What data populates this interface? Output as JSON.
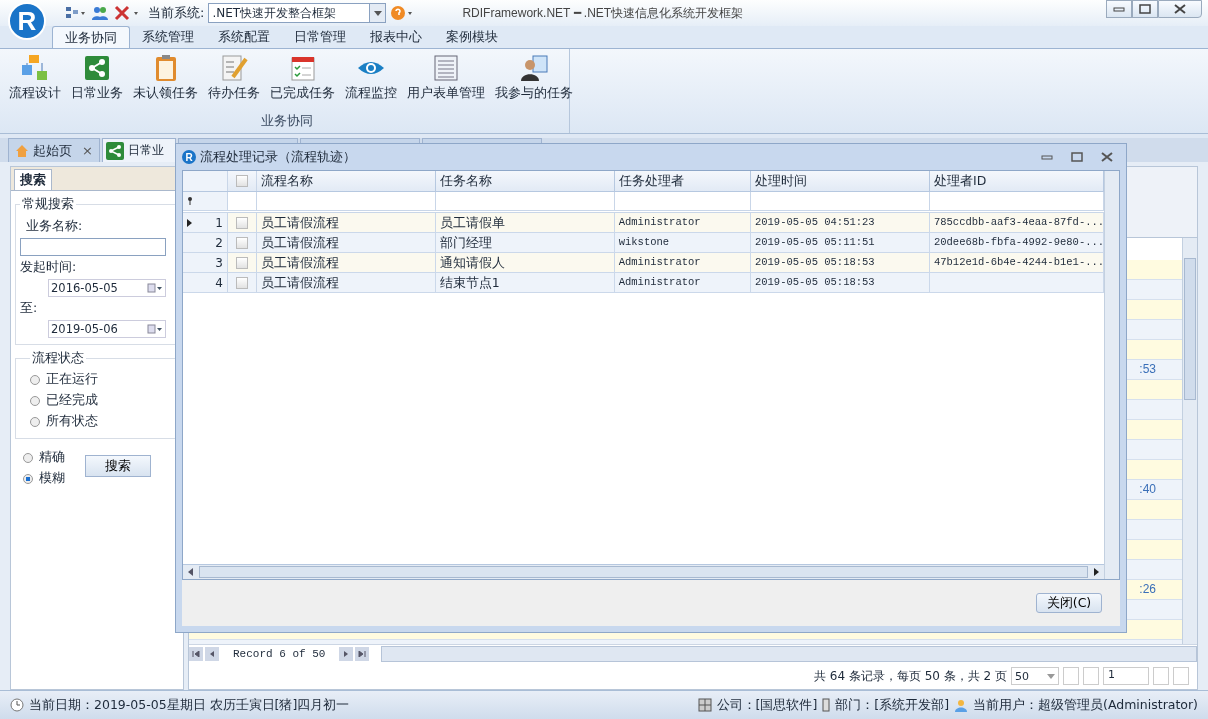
{
  "app": {
    "logo": "R",
    "system_label": "当前系统:",
    "system_value": ".NET快速开发整合框架",
    "title": "RDIFramework.NET ━ .NET快速信息化系统开发框架"
  },
  "ribbon_tabs": [
    {
      "label": "业务协同",
      "selected": true
    },
    {
      "label": "系统管理",
      "selected": false
    },
    {
      "label": "系统配置",
      "selected": false
    },
    {
      "label": "日常管理",
      "selected": false
    },
    {
      "label": "报表中心",
      "selected": false
    },
    {
      "label": "案例模块",
      "selected": false
    }
  ],
  "ribbon_group": {
    "label": "业务协同",
    "buttons": [
      "流程设计",
      "日常业务",
      "未认领任务",
      "待办任务",
      "已完成任务",
      "流程监控",
      "用户表单管理",
      "我参与的任务"
    ]
  },
  "doc_tabs": [
    {
      "label": "起始页",
      "close": "×",
      "selected": false
    },
    {
      "label": "日常业",
      "selected": true
    }
  ],
  "search_panel": {
    "tab": "搜索",
    "group": "常规搜索",
    "name_label": "业务名称:",
    "start_label": "发起时间:",
    "start_value": "2016-05-05",
    "end_label": "至:",
    "end_value": "2019-05-06",
    "status_group": "流程状态",
    "status_options": [
      {
        "label": "正在运行",
        "selected": false
      },
      {
        "label": "已经完成",
        "selected": false
      },
      {
        "label": "所有状态",
        "selected": false
      }
    ],
    "match_options": [
      {
        "label": "精确",
        "selected": false
      },
      {
        "label": "模糊",
        "selected": true
      }
    ],
    "search_button": "搜索"
  },
  "main_grid": {
    "visible_cells": [
      ":53",
      ":40",
      ":26"
    ],
    "pager": "Record 6 of 50",
    "footer": "共 64 条记录，每页 50 条，共 2 页",
    "page_size": "50",
    "page": "1"
  },
  "dialog": {
    "logo": "R",
    "title": "流程处理记录（流程轨迹）",
    "columns": [
      "流程名称",
      "任务名称",
      "任务处理者",
      "处理时间",
      "处理者ID"
    ],
    "rows": [
      {
        "num": "1",
        "current": true,
        "checked": false,
        "cells": [
          "员工请假流程",
          "员工请假单",
          "Administrator",
          "2019-05-05 04:51:23",
          "785ccdbb-aaf3-4eaa-87fd-..."
        ]
      },
      {
        "num": "2",
        "current": false,
        "checked": false,
        "cells": [
          "员工请假流程",
          "部门经理",
          "wikstone",
          "2019-05-05 05:11:51",
          "20dee68b-fbfa-4992-9e80-..."
        ]
      },
      {
        "num": "3",
        "current": false,
        "checked": false,
        "cells": [
          "员工请假流程",
          "通知请假人",
          "Administrator",
          "2019-05-05 05:18:53",
          "47b12e1d-6b4e-4244-b1e1-..."
        ]
      },
      {
        "num": "4",
        "current": false,
        "checked": false,
        "cells": [
          "员工请假流程",
          "结束节点1",
          "Administrator",
          "2019-05-05 05:18:53",
          ""
        ]
      }
    ],
    "close_button": "关闭(C)",
    "header_checked": false
  },
  "status_bar": {
    "date": "当前日期：2019-05-05星期日 农历壬寅日[猪]四月初一",
    "company": "公司：[国思软件]",
    "department": "部门：[系统开发部]",
    "user": "当前用户：超级管理员(Administrator)"
  }
}
